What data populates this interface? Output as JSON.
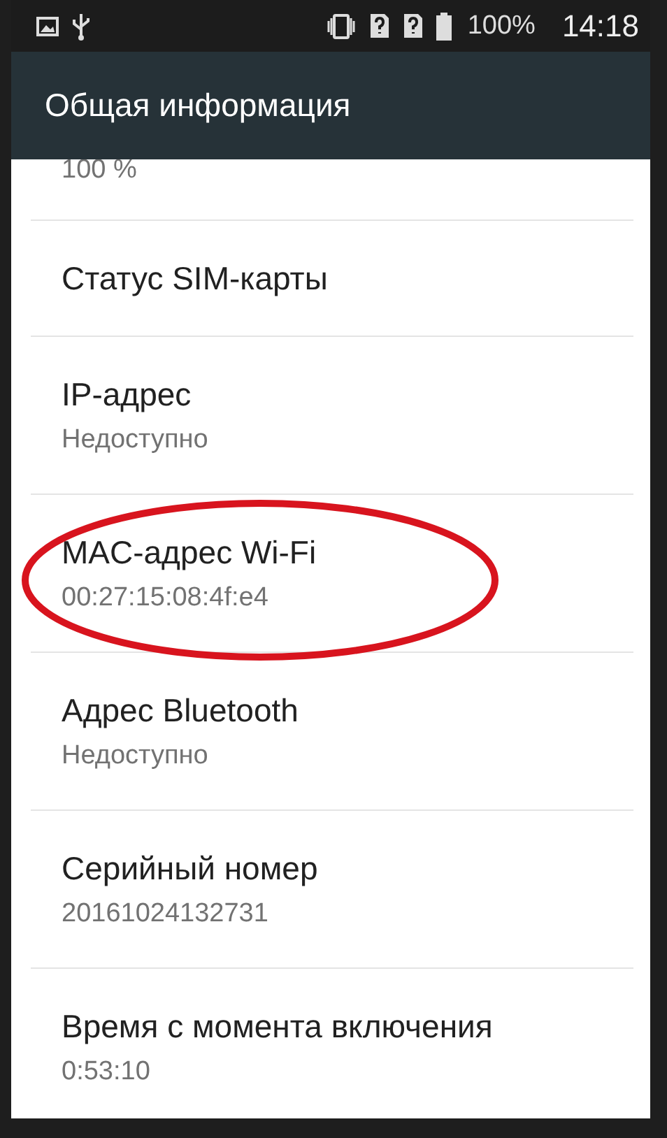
{
  "status_bar": {
    "battery": "100%",
    "time": "14:18"
  },
  "app_bar": {
    "title": "Общая информация"
  },
  "partial_summary": "100 %",
  "items": [
    {
      "title": "Статус SIM-карты",
      "circled": false
    },
    {
      "title": "IP-адрес",
      "summary": "Недоступно",
      "circled": false
    },
    {
      "title": "MAC-адрес Wi-Fi",
      "summary": "00:27:15:08:4f:e4",
      "circled": true
    },
    {
      "title": "Адрес Bluetooth",
      "summary": "Недоступно",
      "circled": false
    },
    {
      "title": "Серийный номер",
      "summary": "20161024132731",
      "circled": false
    },
    {
      "title": "Время с момента включения",
      "summary": "0:53:10",
      "circled": false
    }
  ]
}
